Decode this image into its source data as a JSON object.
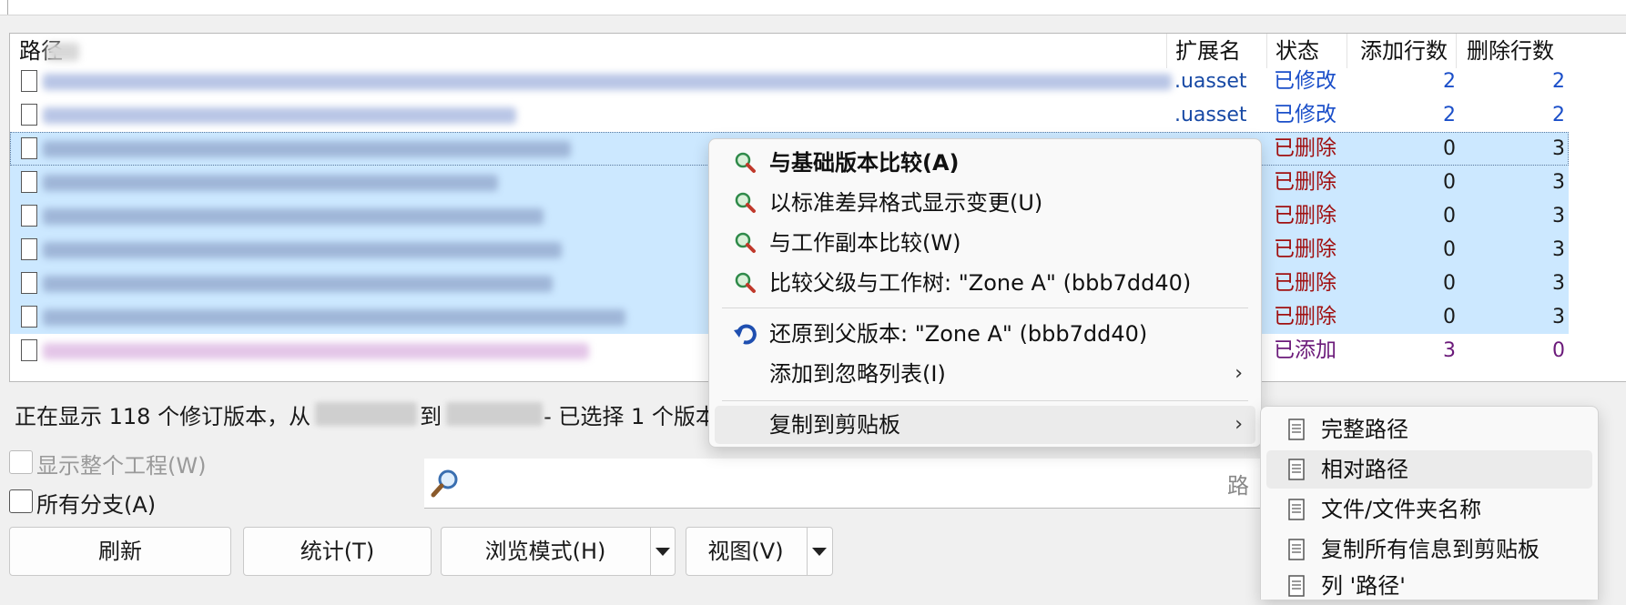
{
  "file_list": {
    "columns": {
      "path": "路径",
      "extension": "扩展名",
      "status": "状态",
      "lines_added": "添加行数",
      "lines_deleted": "删除行数"
    },
    "rows": [
      {
        "ext": ".uasset",
        "status": "已修改",
        "added": "2",
        "deleted": "2",
        "kind": "modified",
        "selected": false
      },
      {
        "ext": ".uasset",
        "status": "已修改",
        "added": "2",
        "deleted": "2",
        "kind": "modified",
        "selected": false
      },
      {
        "ext": "",
        "status": "已删除",
        "added": "0",
        "deleted": "3",
        "kind": "deleted",
        "selected": true
      },
      {
        "ext": "",
        "status": "已删除",
        "added": "0",
        "deleted": "3",
        "kind": "deleted",
        "selected": true
      },
      {
        "ext": "",
        "status": "已删除",
        "added": "0",
        "deleted": "3",
        "kind": "deleted",
        "selected": true
      },
      {
        "ext": "",
        "status": "已删除",
        "added": "0",
        "deleted": "3",
        "kind": "deleted",
        "selected": true
      },
      {
        "ext": "",
        "status": "已删除",
        "added": "0",
        "deleted": "3",
        "kind": "deleted",
        "selected": true
      },
      {
        "ext": "",
        "status": "已删除",
        "added": "0",
        "deleted": "3",
        "kind": "deleted",
        "selected": true
      },
      {
        "ext": "",
        "status": "已添加",
        "added": "3",
        "deleted": "0",
        "kind": "added",
        "selected": false
      }
    ]
  },
  "status_line": {
    "part1": "正在显示 118 个修订版本，从",
    "part2": "到",
    "part3": "- 已选择 1 个版本"
  },
  "options": {
    "show_whole_project": "显示整个工程(W)",
    "all_branches": "所有分支(A)"
  },
  "search": {
    "placeholder": "路"
  },
  "buttons": {
    "refresh": "刷新",
    "statistics": "统计(T)",
    "browse_mode": "浏览模式(H)",
    "view": "视图(V)"
  },
  "context_menu": {
    "compare_base": "与基础版本比较(A)",
    "unified_diff": "以标准差异格式显示变更(U)",
    "compare_working": "与工作副本比较(W)",
    "compare_parent": "比较父级与工作树: \"Zone A\" (bbb7dd40)",
    "revert_parent": "还原到父版本: \"Zone A\" (bbb7dd40)",
    "add_ignore": "添加到忽略列表(I)",
    "copy_clipboard": "复制到剪贴板"
  },
  "submenu": {
    "full_path": "完整路径",
    "relative_path": "相对路径",
    "file_name": "文件/文件夹名称",
    "copy_all": "复制所有信息到剪贴板",
    "column_path": "列 '路径'"
  },
  "colors": {
    "selection": "#cce8ff",
    "modified": "#1b4fc9",
    "deleted": "#a01010",
    "added": "#6b1a7a"
  },
  "icons": {
    "diff": "magnifier-diff-icon",
    "revert": "revert-arrow-icon",
    "file": "document-icon",
    "search": "search-icon"
  }
}
